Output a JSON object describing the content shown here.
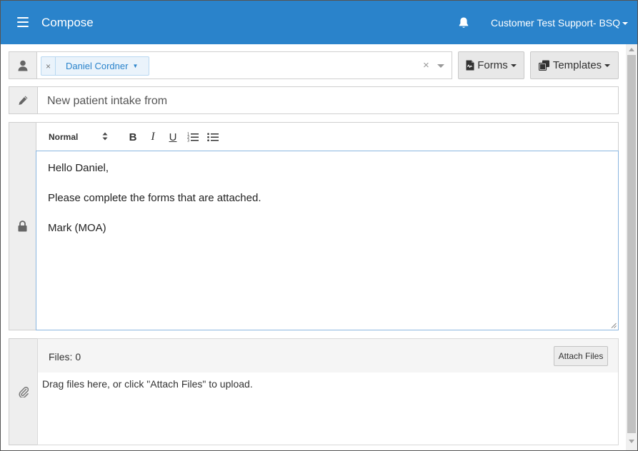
{
  "header": {
    "title": "Compose",
    "user_menu": "Customer Test Support- BSQ",
    "menu_icon": "hamburger-menu-icon",
    "notification_icon": "bell-icon"
  },
  "recipient": {
    "icon": "user-icon",
    "selected": "Daniel Cordner",
    "remove_glyph": "×",
    "clear_glyph": "×"
  },
  "toolbar_buttons": {
    "forms_label": "Forms",
    "templates_label": "Templates"
  },
  "subject": {
    "icon": "pencil-icon",
    "value": "New patient intake from"
  },
  "editor": {
    "icon": "lock-icon",
    "format_select": "Normal",
    "bold": "B",
    "italic": "I",
    "underline": "U",
    "lines": [
      "Hello Daniel,",
      "Please complete the forms that are attached.",
      "Mark (MOA)"
    ]
  },
  "files": {
    "icon": "paperclip-icon",
    "count_label": "Files: 0",
    "attach_label": "Attach Files",
    "dropzone_text": "Drag files here, or click \"Attach Files\" to upload."
  },
  "colors": {
    "header_bg": "#2a83cb",
    "tag_bg": "#eaf3fb",
    "accent": "#2a83cb"
  }
}
